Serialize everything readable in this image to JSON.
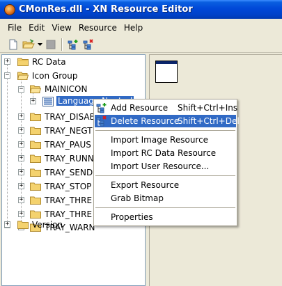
{
  "window": {
    "title": "CMonRes.dll - XN Resource Editor"
  },
  "menubar": {
    "items": [
      {
        "label": "File"
      },
      {
        "label": "Edit"
      },
      {
        "label": "View"
      },
      {
        "label": "Resource"
      },
      {
        "label": "Help"
      }
    ]
  },
  "toolbar": {
    "buttons": [
      "new-file-icon",
      "open-folder-icon",
      "dropdown-arrow-icon",
      "stop-icon",
      "add-resource-icon",
      "delete-resource-icon"
    ]
  },
  "tree": {
    "nodes": [
      {
        "label": "RC Data"
      },
      {
        "label": "Icon Group"
      },
      {
        "label": "MAINICON"
      },
      {
        "label": "Language Neutral"
      },
      {
        "label": "TRAY_DISABLED"
      },
      {
        "label": "TRAY_NEGT"
      },
      {
        "label": "TRAY_PAUS"
      },
      {
        "label": "TRAY_RUNN"
      },
      {
        "label": "TRAY_SEND"
      },
      {
        "label": "TRAY_STOP"
      },
      {
        "label": "TRAY_THRE"
      },
      {
        "label": "TRAY_THRE"
      },
      {
        "label": "TRAY_WARN"
      },
      {
        "label": "Version"
      }
    ]
  },
  "context_menu": {
    "items": [
      {
        "label": "Add Resource",
        "shortcut": "Shift+Ctrl+Ins"
      },
      {
        "label": "Delete Resource",
        "shortcut": "Shift+Ctrl+Del"
      },
      {
        "label": "Import Image Resource"
      },
      {
        "label": "Import RC Data Resource"
      },
      {
        "label": "Import User Resource..."
      },
      {
        "label": "Export Resource"
      },
      {
        "label": "Grab Bitmap"
      },
      {
        "label": "Properties"
      }
    ]
  },
  "colors": {
    "titlebar": "#0048D8",
    "selection": "#316AC5",
    "folder": "#F4D26E"
  }
}
